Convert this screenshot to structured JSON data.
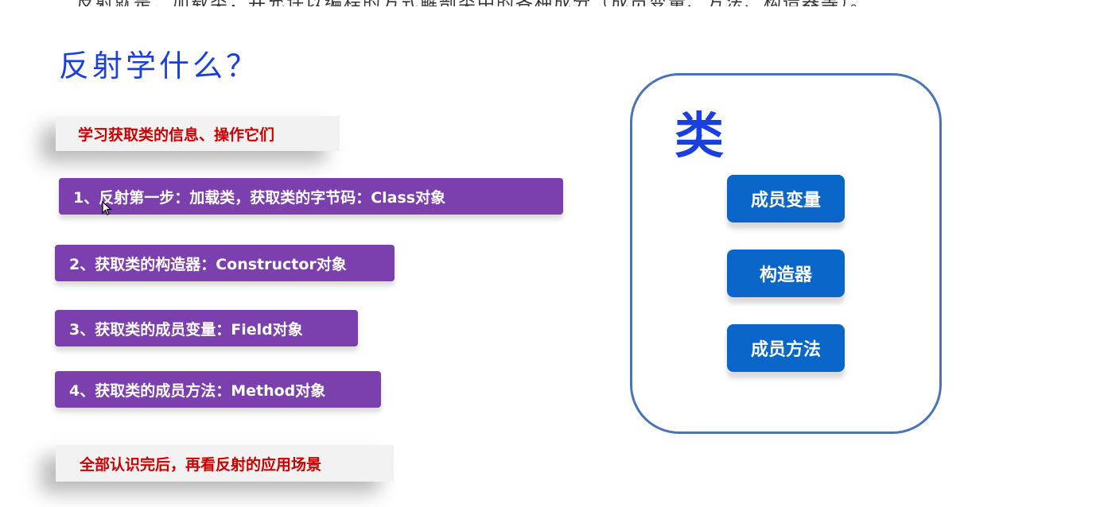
{
  "top_text": "反射就是：加载类，并允许以编程的方式解剖类中的各种成分（成员变量、方法、构造器等）。",
  "heading": "反射学什么？",
  "intro_tag": "学习获取类的信息、操作它们",
  "steps": [
    "1、反射第一步：加载类，获取类的字节码：Class对象",
    "2、获取类的构造器：Constructor对象",
    "3、获取类的成员变量：Field对象",
    "4、获取类的成员方法：Method对象"
  ],
  "outro_tag": "全部认识完后，再看反射的应用场景",
  "class_box": {
    "title": "类",
    "members": [
      "成员变量",
      "构造器",
      "成员方法"
    ]
  },
  "colors": {
    "heading": "#1a3fe0",
    "tag_text": "#cc0000",
    "step_bg": "#7b3fae",
    "member_bg": "#0a66c8",
    "box_border": "#4a74b8"
  }
}
